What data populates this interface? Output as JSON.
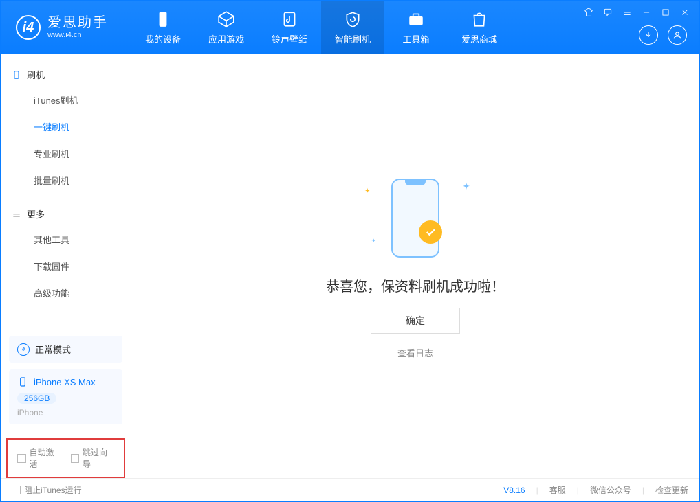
{
  "brand": {
    "title": "爱思助手",
    "subtitle": "www.i4.cn"
  },
  "nav": {
    "items": [
      {
        "label": "我的设备"
      },
      {
        "label": "应用游戏"
      },
      {
        "label": "铃声壁纸"
      },
      {
        "label": "智能刷机"
      },
      {
        "label": "工具箱"
      },
      {
        "label": "爱思商城"
      }
    ],
    "active_index": 3
  },
  "sidebar": {
    "section1": {
      "title": "刷机",
      "items": [
        "iTunes刷机",
        "一键刷机",
        "专业刷机",
        "批量刷机"
      ],
      "active_index": 1
    },
    "section2": {
      "title": "更多",
      "items": [
        "其他工具",
        "下载固件",
        "高级功能"
      ]
    }
  },
  "device": {
    "mode_label": "正常模式",
    "name": "iPhone XS Max",
    "capacity": "256GB",
    "type": "iPhone"
  },
  "options": {
    "auto_activate": "自动激活",
    "skip_wizard": "跳过向导"
  },
  "main": {
    "success_text": "恭喜您，保资料刷机成功啦！",
    "ok_label": "确定",
    "view_log": "查看日志"
  },
  "footer": {
    "block_itunes": "阻止iTunes运行",
    "version": "V8.16",
    "support": "客服",
    "wechat": "微信公众号",
    "check_update": "检查更新"
  }
}
